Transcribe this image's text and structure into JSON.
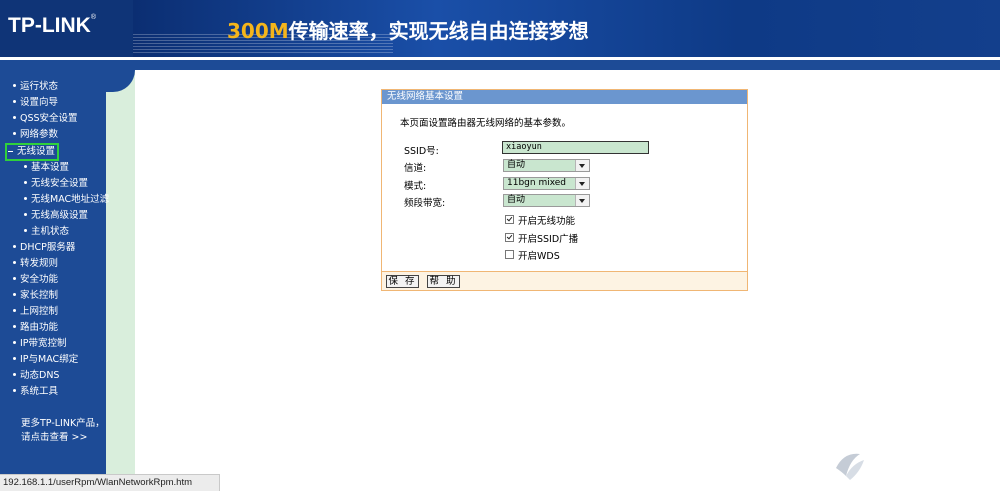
{
  "header": {
    "logo": "TP-LINK",
    "logo_mark": "®",
    "slogan_highlight": "300M",
    "slogan_rest": "传输速率，实现无线自由连接梦想"
  },
  "sidebar": {
    "items": [
      {
        "label": "运行状态"
      },
      {
        "label": "设置向导"
      },
      {
        "label": "QSS安全设置"
      },
      {
        "label": "网络参数"
      },
      {
        "label": "无线设置",
        "active": true
      },
      {
        "label": "基本设置"
      },
      {
        "label": "无线安全设置"
      },
      {
        "label": "无线MAC地址过滤"
      },
      {
        "label": "无线高级设置"
      },
      {
        "label": "主机状态"
      },
      {
        "label": "DHCP服务器"
      },
      {
        "label": "转发规则"
      },
      {
        "label": "安全功能"
      },
      {
        "label": "家长控制"
      },
      {
        "label": "上网控制"
      },
      {
        "label": "路由功能"
      },
      {
        "label": "IP带宽控制"
      },
      {
        "label": "IP与MAC绑定"
      },
      {
        "label": "动态DNS"
      },
      {
        "label": "系统工具"
      }
    ],
    "more_line1": "更多TP-LINK产品，",
    "more_line2": "请点击查看 >>"
  },
  "panel": {
    "title": "无线网络基本设置",
    "description": "本页面设置路由器无线网络的基本参数。",
    "ssid_label": "SSID号:",
    "ssid_value": "xiaoyun",
    "channel_label": "信道:",
    "channel_value": "自动",
    "mode_label": "模式:",
    "mode_value": "11bgn mixed",
    "bandwidth_label": "频段带宽:",
    "bandwidth_value": "自动",
    "enable_wireless_label": "开启无线功能",
    "enable_wireless": true,
    "enable_ssid_broadcast_label": "开启SSID广播",
    "enable_ssid_broadcast": true,
    "enable_wds_label": "开启WDS",
    "enable_wds": false,
    "save_label": "保 存",
    "help_label": "帮 助"
  },
  "statusbar": {
    "url": "192.168.1.1/userRpm/WlanNetworkRpm.htm"
  },
  "colors": {
    "nav_blue": "#1d4b96",
    "panel_header": "#6b96cf",
    "panel_border": "#f0b674",
    "field_green": "#c9e6cf",
    "active_outline": "#2fd03c"
  }
}
